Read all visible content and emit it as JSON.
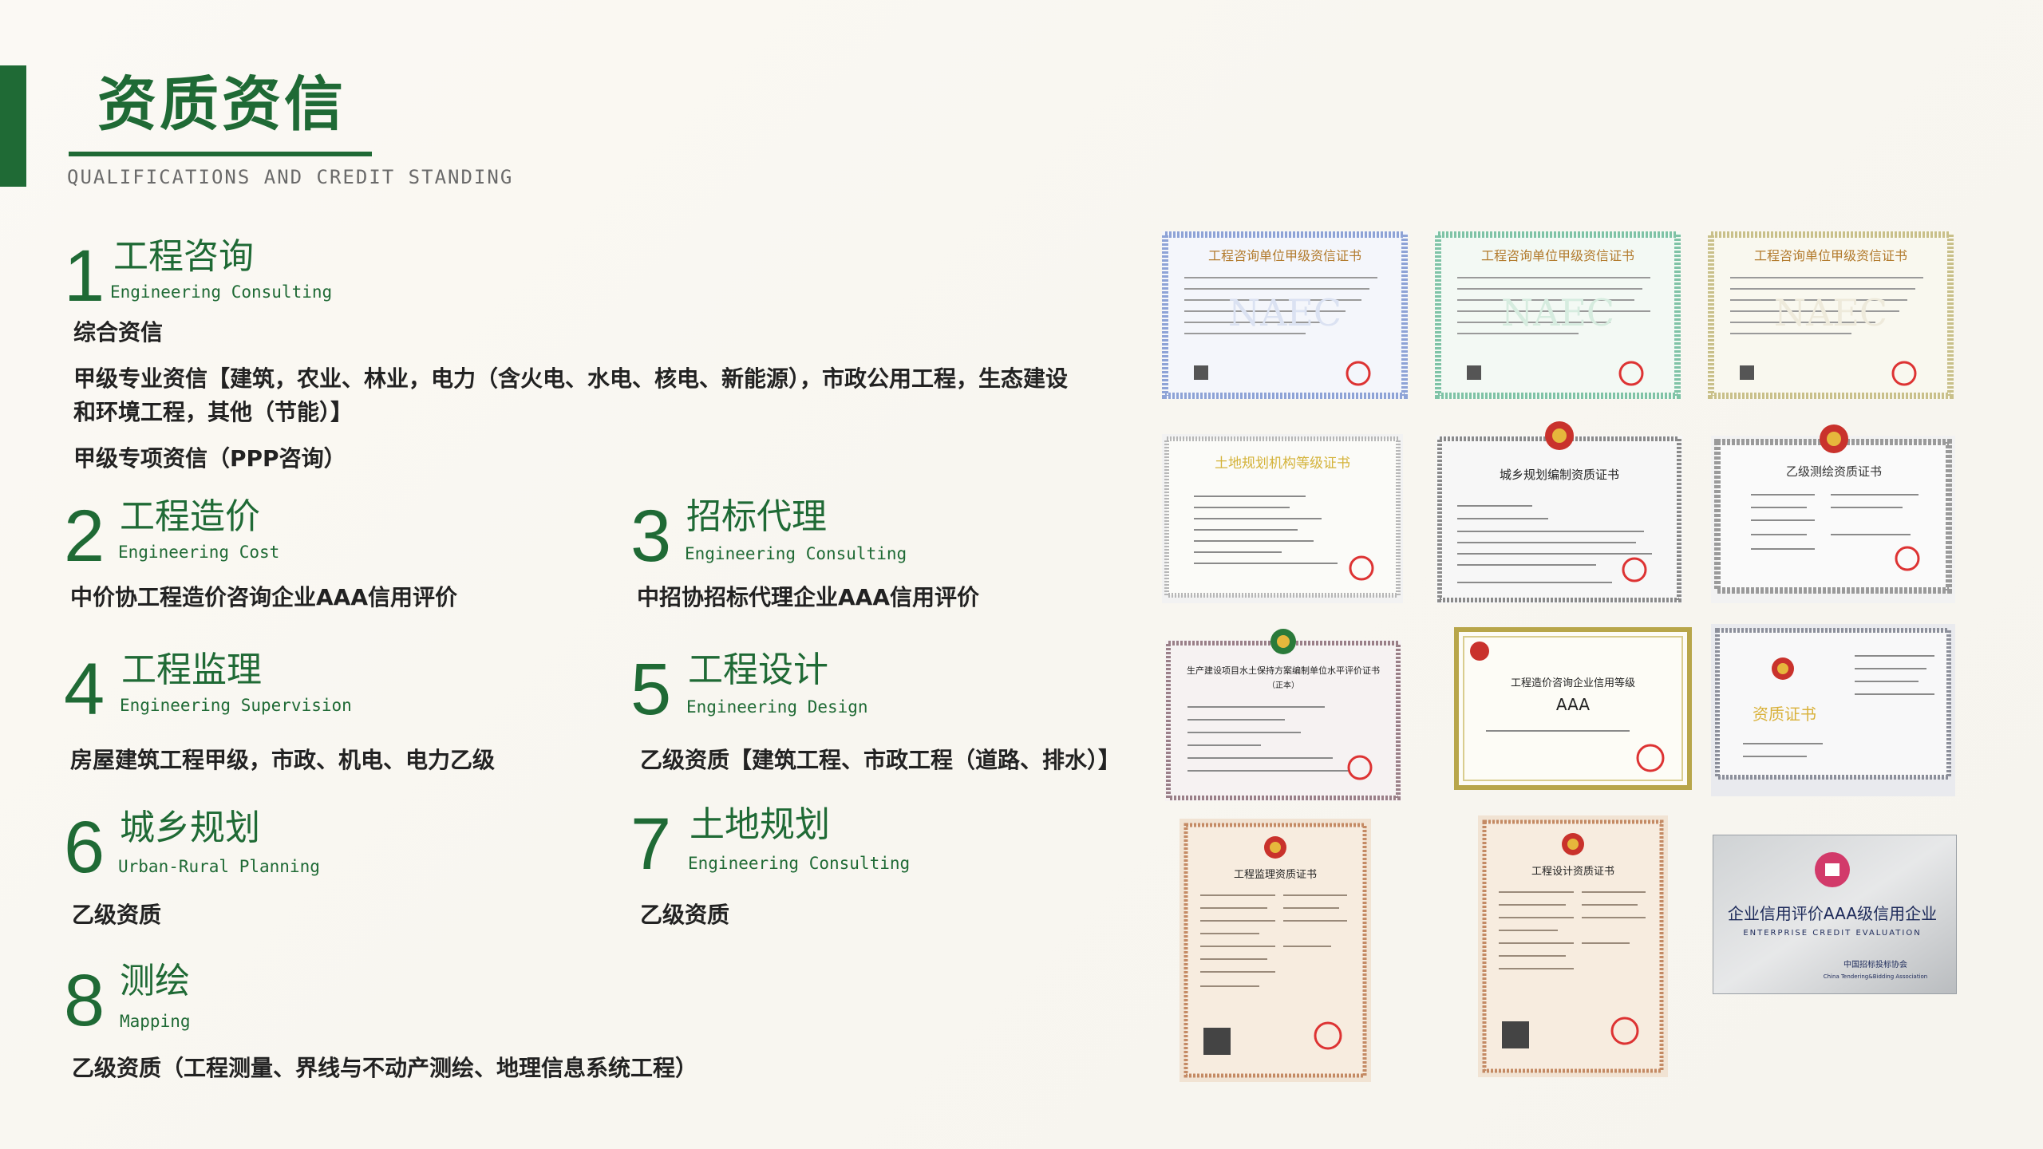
{
  "header": {
    "title": "资质资信",
    "subtitle": "QUALIFICATIONS AND CREDIT STANDING"
  },
  "sections": [
    {
      "num": "1",
      "cn": "工程咨询",
      "en": "Engineering Consulting",
      "items": [
        "综合资信",
        "甲级专业资信【建筑，农业、林业，电力（含火电、水电、核电、新能源），市政公用工程，生态建设和环境工程，其他（节能）】",
        "甲级专项资信（PPP咨询）"
      ]
    },
    {
      "num": "2",
      "cn": "工程造价",
      "en": "Engineering Cost",
      "items": [
        "中价协工程造价咨询企业AAA信用评价"
      ]
    },
    {
      "num": "3",
      "cn": "招标代理",
      "en": "Engineering Consulting",
      "items": [
        "中招协招标代理企业AAA信用评价"
      ]
    },
    {
      "num": "4",
      "cn": "工程监理",
      "en": "Engineering Supervision",
      "items": [
        "房屋建筑工程甲级，市政、机电、电力乙级"
      ]
    },
    {
      "num": "5",
      "cn": "工程设计",
      "en": "Engineering Design",
      "items": [
        "乙级资质【建筑工程、市政工程（道路、排水）】"
      ]
    },
    {
      "num": "6",
      "cn": "城乡规划",
      "en": "Urban-Rural Planning",
      "items": [
        "乙级资质"
      ]
    },
    {
      "num": "7",
      "cn": "土地规划",
      "en": "Engineering Consulting",
      "items": [
        "乙级资质"
      ]
    },
    {
      "num": "8",
      "cn": "测绘",
      "en": "Mapping",
      "items": [
        "乙级资质（工程测量、界线与不动产测绘、地理信息系统工程）"
      ]
    }
  ],
  "certificates": [
    {
      "title": "工程咨询单位甲级资信证书",
      "accent": "#8ea3d6"
    },
    {
      "title": "工程咨询单位甲级资信证书",
      "accent": "#7fc3a6"
    },
    {
      "title": "工程咨询单位甲级资信证书",
      "accent": "#c9c08a"
    },
    {
      "title": "土地规划机构等级证书",
      "accent": "#b7b7b7"
    },
    {
      "title": "城乡规划编制资质证书",
      "accent": "#8a8a8a"
    },
    {
      "title": "乙级测绘资质证书",
      "accent": "#9a9a9a"
    },
    {
      "title": "生产建设项目水土保持方案编制单位水平评价证书",
      "note": "（正本）",
      "accent": "#9a7f88"
    },
    {
      "title": "工程造价咨询企业信用等级",
      "rating": "AAA",
      "accent": "#b8a64a"
    },
    {
      "title": "资质证书",
      "accent": "#8c8f9a"
    },
    {
      "title": "工程监理资质证书",
      "accent": "#c48a64"
    },
    {
      "title": "工程设计资质证书",
      "accent": "#c48a64"
    },
    {
      "title": "企业信用评价AAA级信用企业",
      "en": "ENTERPRISE CREDIT EVALUATION",
      "org": "中国招标投标协会",
      "org_en": "China Tendering&Bidding Association",
      "accent": "#9aa0a6"
    }
  ]
}
